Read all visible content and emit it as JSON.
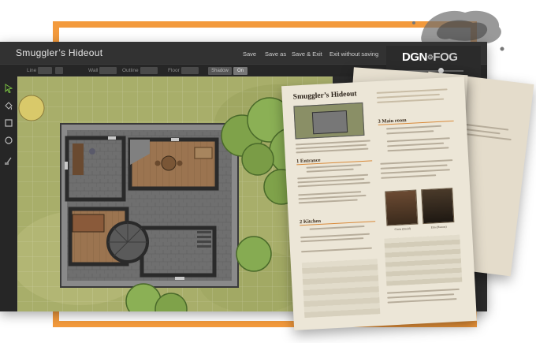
{
  "app": {
    "title": "Smuggler’s Hideout",
    "menu": [
      "Save",
      "Save as",
      "Save & Exit",
      "Exit without saving"
    ],
    "logo_main": "DGN",
    "logo_sub": "FOG"
  },
  "toolbar": {
    "labels": [
      "Line",
      "Wall",
      "Outline",
      "Floor"
    ],
    "shadow_label": "Shadow",
    "shadow_state": "On"
  },
  "sidebar_icons": [
    "select-arrow-icon",
    "paint-bucket-icon",
    "square-tool-icon",
    "circle-tool-icon",
    "brush-icon"
  ],
  "paper_main": {
    "title": "Smuggler’s Hideout",
    "sections": [
      "1 Entrance",
      "2 Kitchen",
      "3 Main room"
    ],
    "portrait_captions": [
      "Cirrin (Druid)",
      "Elm (Human)"
    ]
  },
  "colors": {
    "accent_orange": "#f39a3c",
    "window_bg": "#2b2b2b",
    "paper": "#ece6d7"
  }
}
